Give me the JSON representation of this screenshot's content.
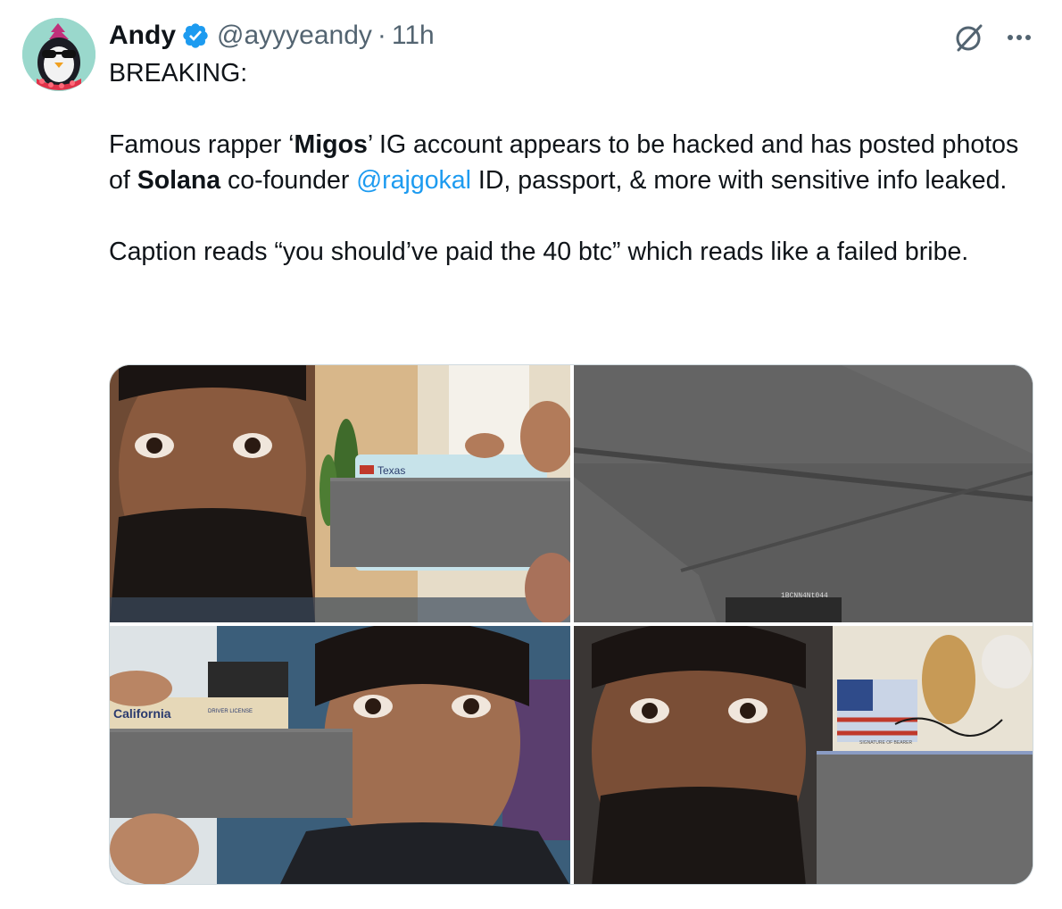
{
  "author": {
    "display_name": "Andy",
    "handle": "@ayyyeandy",
    "separator": "·",
    "timestamp": "11h",
    "verified": true
  },
  "colors": {
    "verified_blue": "#1d9bf0",
    "mention_blue": "#1d9bf0",
    "secondary_text": "#536471",
    "text": "#0f1419"
  },
  "icons": {
    "grok": "grok-icon",
    "more": "more-icon",
    "verified": "verified-badge-icon"
  },
  "tweet": {
    "line1": "BREAKING:",
    "p2_a": "Famous rapper ‘",
    "p2_bold1": "Migos",
    "p2_b": "’ IG account appears to be hacked and has posted photos of ",
    "p2_bold2": "Solana",
    "p2_c": " co-founder ",
    "p2_mention": "@rajgokal",
    "p2_d": " ID, passport, & more with sensitive info leaked.",
    "p3": "Caption reads “you should’ve paid the 40 btc” which reads like a failed bribe."
  },
  "media": {
    "photos": [
      {
        "card_label": "Texas"
      },
      {
        "card_label": "1BCNN4Nt044"
      },
      {
        "card_label": "California",
        "card_sublabel": "DRIVER LICENSE"
      },
      {
        "card_label": "SIGNATURE OF BEARER"
      }
    ]
  }
}
